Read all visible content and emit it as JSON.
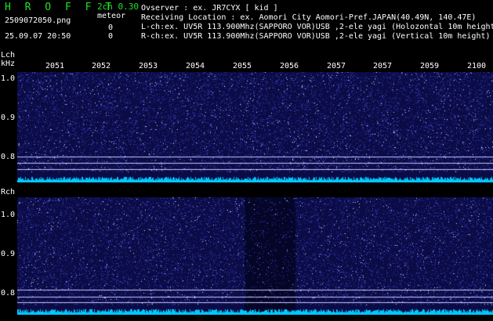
{
  "header": {
    "title": "H R O F F T",
    "mode": "2ch 0.30",
    "meteor_label": "meteor",
    "filename": "2509072050.png",
    "datetime": "25.09.07 20:50",
    "lch_count": "0",
    "rch_count": "0"
  },
  "observation": {
    "observer": "Ovserver          : ex. JR7CYX [ kid ]",
    "location": "Receiving Location : ex. Aomori City Aomori-Pref.JAPAN(40.49N, 140.47E)",
    "lch": "L-ch:ex. UV5R 113.900Mhz(SAPPORO VOR)USB ,2-ele yagi (Holozontal 10m height)",
    "rch": "R-ch:ex. UV5R 113.900Mhz(SAPPORO VOR)USB ,2-ele yagi (Vertical 10m height)"
  },
  "lch_panel": {
    "channel_label": "Lch",
    "unit_label": "kHz",
    "ticks": [
      "1.0",
      "0.9",
      "0.8"
    ]
  },
  "rch_panel": {
    "channel_label": "Rch",
    "ticks": [
      "1.0",
      "0.9",
      "0.8"
    ]
  },
  "time_labels": [
    "2051",
    "2052",
    "2053",
    "2054",
    "2055",
    "2056",
    "2057",
    "2057",
    "2059",
    "2100"
  ],
  "colors": {
    "header_green": "#22e022",
    "background": "#000000",
    "spectrogram_bg": "#0b0b46",
    "noise_floor": "#00c8ff",
    "grid_line": "#c8c8ff"
  }
}
